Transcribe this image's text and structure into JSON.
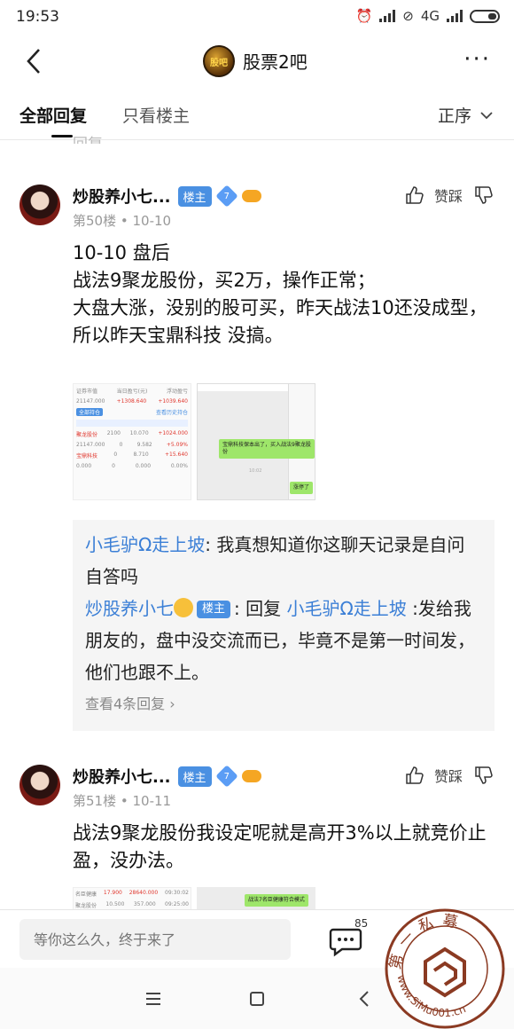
{
  "status_bar": {
    "time": "19:53",
    "network": "4G"
  },
  "nav": {
    "forum_title": "股票2吧",
    "logo_text": "股吧"
  },
  "tabs": {
    "all": "全部回复",
    "owner_only": "只看楼主",
    "sort": "正序"
  },
  "cut_text": "回复",
  "posts": [
    {
      "username": "炒股养小七...",
      "owner_badge": "楼主",
      "level": "7",
      "floor": "第50楼",
      "date": "10-10",
      "like_label": "赞踩",
      "content": [
        "10-10 盘后",
        "战法9聚龙股份，买2万，操作正常；",
        "大盘大涨，没别的股可买，昨天战法10还没成型，所以昨天宝鼎科技 没搞。"
      ]
    },
    {
      "username": "炒股养小七...",
      "owner_badge": "楼主",
      "level": "7",
      "floor": "第51楼",
      "date": "10-11",
      "like_label": "赞踩",
      "content": [
        "战法9聚龙股份我设定呢就是高开3%以上就竞价止盈，没办法。"
      ]
    }
  ],
  "shot_left": {
    "row1": [
      "证券市值",
      "当日盈亏(元)",
      "浮动盈亏"
    ],
    "row2": [
      "21147.000",
      "+1308.640",
      "+1039.640"
    ],
    "button": "全部持仓",
    "link": "查看历史持仓",
    "stock1": [
      "聚龙股份",
      "2100",
      "10.070",
      "+1024.000"
    ],
    "stock1b": [
      "21147.000",
      "0",
      "9.582",
      "+5.09%"
    ],
    "stock2": [
      "宝鼎科技",
      "0",
      "8.710",
      "+15.640"
    ],
    "stock2b": [
      "0.000",
      "0",
      "0.000",
      "0.00%"
    ]
  },
  "shot_right": {
    "bubble1": "宝鼎科技保本出了，买入战法9聚龙股份",
    "time": "10:02",
    "bubble2": "涨停了"
  },
  "reply": {
    "user1": "小毛驴Ω走上坡",
    "text1": "我真想知道你这聊天记录是自问自答吗",
    "user2": "炒股养小七",
    "owner_badge": "楼主",
    "reply_word": "回复",
    "target": "小毛驴Ω走上坡",
    "text2": ":发给我朋友的，盘中没交流而已，毕竟不是第一时间发，他们也跟不上。",
    "view_more": "查看4条回复"
  },
  "shot2": {
    "label": "名臣健康",
    "v1": "17.900",
    "v2": "28640.000",
    "v3": "09:30:02",
    "label2": "聚龙股份",
    "v4": "10.500",
    "v5": "357.000",
    "v6": "09:25:00",
    "bubble": "战法7名臣健康符合模式"
  },
  "bottom": {
    "placeholder": "等你这么久，终于来了",
    "comment_count": "85"
  },
  "watermark": {
    "text_top": "第一私募",
    "text_bottom": "www.SiMu001.cn"
  }
}
